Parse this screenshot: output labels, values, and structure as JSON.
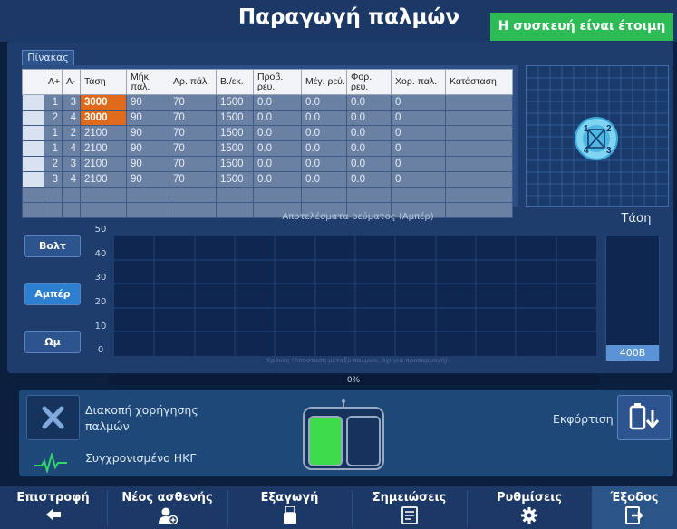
{
  "header": {
    "title": "Παραγωγή παλμών",
    "status": "Η συσκευή είναι έτοιμη"
  },
  "table_tab": "Πίνακας",
  "table": {
    "headers": [
      "",
      "A+",
      "A-",
      "Τάση",
      "Μήκ. παλ.",
      "Αρ. πάλ.",
      "Β./εκ.",
      "Προβ. ρευ.",
      "Μέγ. ρεύ.",
      "Φορ. ρεύ.",
      "Χορ. παλ.",
      "Κατάσταση"
    ],
    "rows": [
      [
        "",
        "1",
        "3",
        "3000",
        "90",
        "70",
        "1500",
        "0.0",
        "0.0",
        "0.0",
        "0",
        ""
      ],
      [
        "",
        "2",
        "4",
        "3000",
        "90",
        "70",
        "1500",
        "0.0",
        "0.0",
        "0.0",
        "0",
        ""
      ],
      [
        "",
        "1",
        "2",
        "2100",
        "90",
        "70",
        "1500",
        "0.0",
        "0.0",
        "0.0",
        "0",
        ""
      ],
      [
        "",
        "1",
        "4",
        "2100",
        "90",
        "70",
        "1500",
        "0.0",
        "0.0",
        "0.0",
        "0",
        ""
      ],
      [
        "",
        "2",
        "3",
        "2100",
        "90",
        "70",
        "1500",
        "0.0",
        "0.0",
        "0.0",
        "0",
        ""
      ],
      [
        "",
        "3",
        "4",
        "2100",
        "90",
        "70",
        "1500",
        "0.0",
        "0.0",
        "0.0",
        "0",
        ""
      ]
    ]
  },
  "electrode_map": {
    "labels": [
      "1",
      "2",
      "3",
      "4"
    ]
  },
  "chart": {
    "title": "Αποτελέσματα ρεύματος (Αμπέρ)",
    "y_ticks": [
      "50",
      "40",
      "30",
      "20",
      "10",
      "0"
    ],
    "x_label": "Χρόνος (Απόσταση μεταξύ παλμών, όχι για προσαρμογή).",
    "buttons": [
      "Βολτ",
      "Αμπέρ",
      "Ωμ"
    ],
    "selected": "Αμπέρ"
  },
  "voltage_panel": {
    "label": "Τάση",
    "value": "400Β"
  },
  "progress": {
    "text": "0%",
    "fraction": 0
  },
  "controls": {
    "stop_label": "Διακοπή χορήγησης παλμών",
    "ecg_label": "Συγχρονισμένο ΗΚΓ",
    "discharge_label": "Εκφόρτιση"
  },
  "colors": {
    "status_green": "#2dbb55",
    "highlight_orange": "#e06a1c",
    "pedal_green": "#3ddc4a",
    "ecg_green": "#2fd86a"
  },
  "nav": [
    {
      "label": "Επιστροφή",
      "icon": "arrow-left-icon"
    },
    {
      "label": "Νέος ασθενής",
      "icon": "add-user-icon"
    },
    {
      "label": "Εξαγωγή",
      "icon": "usb-icon"
    },
    {
      "label": "Σημειώσεις",
      "icon": "notes-icon"
    },
    {
      "label": "Ρυθμίσεις",
      "icon": "gear-icon"
    },
    {
      "label": "Έξοδος",
      "icon": "exit-icon"
    }
  ]
}
